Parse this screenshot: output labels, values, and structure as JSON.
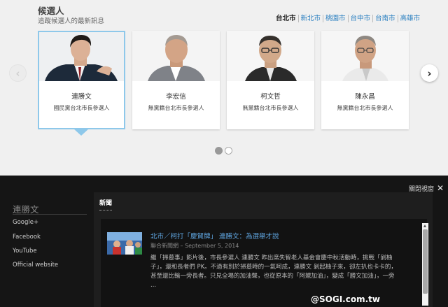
{
  "section": {
    "title": "候選人",
    "subtitle": "追蹤候選人的最新訊息"
  },
  "city_tabs": [
    "台北市",
    "新北市",
    "桃園市",
    "台中市",
    "台南市",
    "高雄市"
  ],
  "active_city": "台北市",
  "candidates": [
    {
      "name": "連勝文",
      "role": "國民黨台北市長參選人",
      "selected": true
    },
    {
      "name": "李宏信",
      "role": "無黨籍台北市長參選人",
      "selected": false
    },
    {
      "name": "柯文哲",
      "role": "無黨籍台北市長參選人",
      "selected": false
    },
    {
      "name": "陳永昌",
      "role": "無黨籍台北市長參選人",
      "selected": false
    }
  ],
  "carousel": {
    "pages": 2,
    "current_page": 1
  },
  "detail": {
    "close_label": "關閉視窗",
    "candidate_name": "連勝文",
    "links": [
      "Google+",
      "Facebook",
      "YouTube",
      "Official website"
    ],
    "tab_label": "新聞",
    "news": {
      "title": "北市／柯打「慶賀牌」 連勝文：為選舉才說",
      "meta": "聯合新聞網 – September 5, 2014",
      "text": "繼「掃墓事」影片後，市長參選人 連勝文 昨出席失智老人基金會慶中秋活動時，挑戰「剝柚子」，還和長者們 PK。不過有別於掃墓時的一氣呵成，連勝文 剝起柚子來，卻左扒也卡卡的，甚至還比輸一旁長者。只見全場的加油聲，也從原本的「阿嬤加油」，變成「勝文加油」，一旁 ..."
    }
  },
  "watermark": "@SOGI.com.tw",
  "colors": {
    "accent_blue": "#2a7fc0",
    "selected_border": "#8ec8ea",
    "dark_panel": "#151515",
    "link_blue": "#5fa5e0"
  }
}
